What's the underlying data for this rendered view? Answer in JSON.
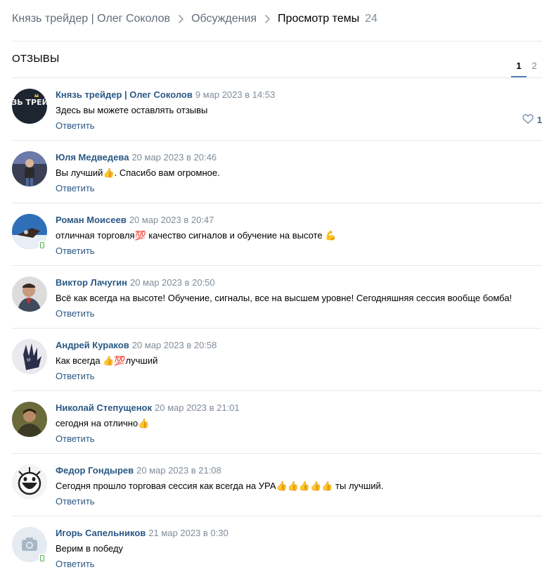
{
  "breadcrumb": {
    "group": "Князь трейдер | Олег Соколов",
    "discussions": "Обсуждения",
    "current": "Просмотр темы",
    "count": "24"
  },
  "topic": {
    "title": "ОТЗЫВЫ"
  },
  "pagination": {
    "pages": [
      "1",
      "2"
    ],
    "active": "1"
  },
  "reply_label": "Ответить",
  "comments": [
    {
      "author": "Князь трейдер | Олег Соколов",
      "date": "9 мар 2023 в 14:53",
      "text": "Здесь вы можете оставлять отзывы",
      "likes": "1",
      "avatar_label": "КНЯЗЬ ТРЕЙДЕР"
    },
    {
      "author": "Юля Медведева",
      "date": "20 мар 2023 в 20:46",
      "text": "Вы лучший👍. Спасибо вам огромное."
    },
    {
      "author": "Роман Моисеев",
      "date": "20 мар 2023 в 20:47",
      "text": "отличная торговля💯 качество сигналов и обучение на высоте 💪",
      "online_mobile": true
    },
    {
      "author": "Виктор Лачугин",
      "date": "20 мар 2023 в 20:50",
      "text": "Всё как всегда на высоте! Обучение, сигналы, все на высшем уровне! Сегодняшняя сессия вообще бомба!"
    },
    {
      "author": "Андрей Кураков",
      "date": "20 мар 2023 в 20:58",
      "text": "Как всегда 👍💯лучший"
    },
    {
      "author": "Николай Степущенок",
      "date": "20 мар 2023 в 21:01",
      "text": "сегодня на отлично👍"
    },
    {
      "author": "Федор Гондырев",
      "date": "20 мар 2023 в 21:08",
      "text": "Сегодня прошло торговая сессия как всегда на УРА👍👍👍👍👍 ты лучший."
    },
    {
      "author": "Игорь Сапельников",
      "date": "21 мар 2023 в 0:30",
      "text": "Верим в победу",
      "online_mobile": true
    }
  ],
  "colors": {
    "link": "#2a5885",
    "meta": "#818c99",
    "divider": "#e7e8ec",
    "accent": "#5181b8"
  }
}
